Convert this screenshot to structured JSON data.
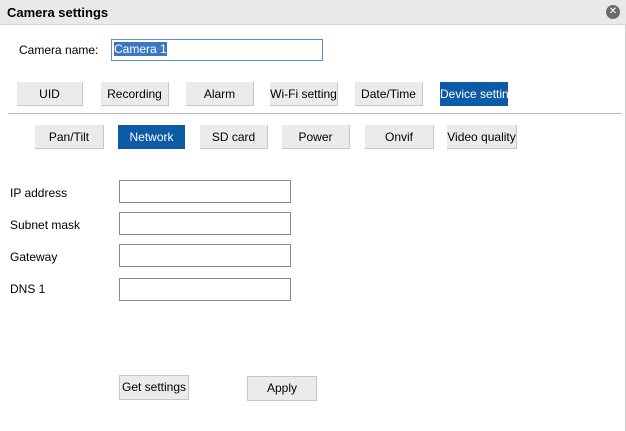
{
  "window": {
    "title": "Camera settings",
    "close_icon": "close-icon"
  },
  "camera_name": {
    "label": "Camera name:",
    "value": "Camera 1"
  },
  "tabs": [
    {
      "label": "UID",
      "active": false
    },
    {
      "label": "Recording",
      "active": false
    },
    {
      "label": "Alarm",
      "active": false
    },
    {
      "label": "Wi-Fi setting",
      "active": false
    },
    {
      "label": "Date/Time",
      "active": false
    },
    {
      "label": "Device setting",
      "active": true
    }
  ],
  "subtabs": [
    {
      "label": "Pan/Tilt",
      "active": false
    },
    {
      "label": "Network",
      "active": true
    },
    {
      "label": "SD card",
      "active": false
    },
    {
      "label": "Power",
      "active": false
    },
    {
      "label": "Onvif",
      "active": false
    },
    {
      "label": "Video quality",
      "active": false
    }
  ],
  "network": {
    "fields": [
      {
        "label": "IP address",
        "value": ""
      },
      {
        "label": "Subnet mask",
        "value": ""
      },
      {
        "label": "Gateway",
        "value": ""
      },
      {
        "label": "DNS 1",
        "value": ""
      }
    ]
  },
  "actions": {
    "get_settings_label": "Get settings",
    "apply_label": "Apply"
  },
  "colors": {
    "active_tab": "#0d5aa7",
    "titlebar": "#e9e9e9",
    "button": "#ebebeb"
  }
}
